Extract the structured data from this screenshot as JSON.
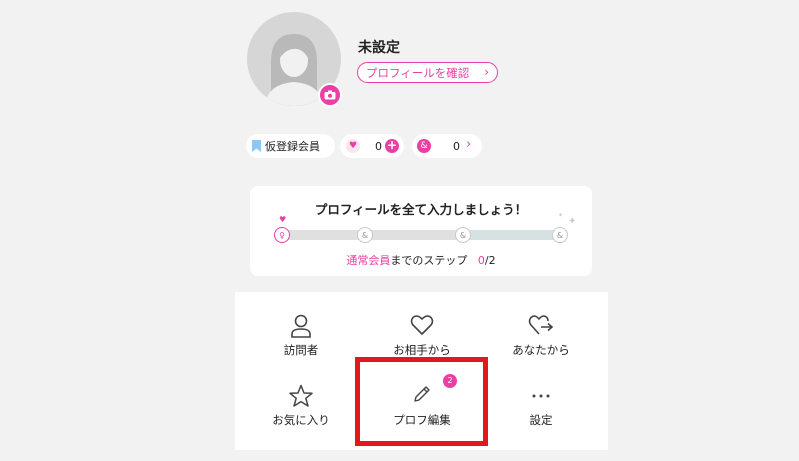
{
  "profile": {
    "name": "未設定",
    "confirm_link_label": "プロフィールを確認",
    "avatar_icon": "female-silhouette-icon",
    "camera_icon": "camera-icon"
  },
  "status": {
    "member_label": "仮登録会員",
    "points_value": "0",
    "likes_value": "0"
  },
  "progress": {
    "title": "プロフィールを全て入力しましょう！",
    "caption_highlight": "通常会員",
    "caption_rest": "までのステップ",
    "current_step": "0",
    "total_steps": "/2"
  },
  "menu": {
    "items": [
      {
        "label": "訪問者",
        "icon": "person-icon"
      },
      {
        "label": "お相手から",
        "icon": "heart-icon"
      },
      {
        "label": "あなたから",
        "icon": "heart-arrow-icon"
      },
      {
        "label": "お気に入り",
        "icon": "star-icon"
      },
      {
        "label": "プロフ編集",
        "icon": "pencil-icon",
        "badge": "2"
      },
      {
        "label": "設定",
        "icon": "more-icon"
      }
    ]
  },
  "colors": {
    "accent": "#ea3fa4",
    "highlight": "#e01a1a",
    "background": "#f2f2f2"
  }
}
